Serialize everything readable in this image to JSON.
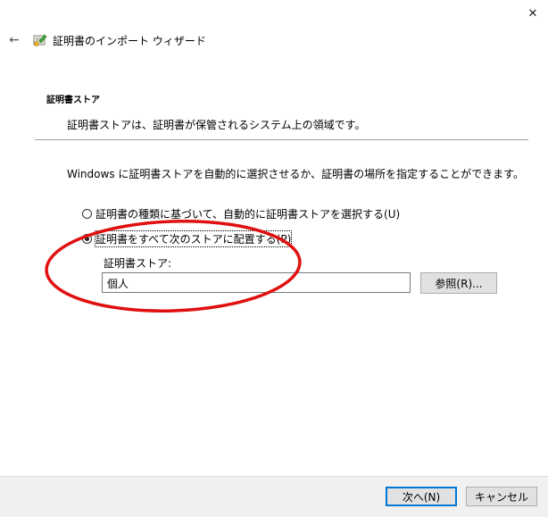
{
  "window": {
    "title": "証明書のインポート ウィザード",
    "close_glyph": "✕",
    "back_glyph": "←"
  },
  "header": {
    "heading": "証明書ストア",
    "description": "証明書ストアは、証明書が保管されるシステム上の領域です。"
  },
  "main": {
    "instruction": "Windows に証明書ストアを自動的に選択させるか、証明書の場所を指定することができます。",
    "options": [
      {
        "label": "証明書の種類に基づいて、自動的に証明書ストアを選択する(U)",
        "checked": false
      },
      {
        "label": "証明書をすべて次のストアに配置する(P)",
        "checked": true
      }
    ],
    "store_label": "証明書ストア:",
    "store_value": "個人",
    "browse_label": "参照(R)..."
  },
  "footer": {
    "next_label": "次へ(N)",
    "cancel_label": "キャンセル"
  },
  "colors": {
    "annotation": "#e01010",
    "primary_border": "#0078d7",
    "footer_bg": "#f0f0f0"
  }
}
